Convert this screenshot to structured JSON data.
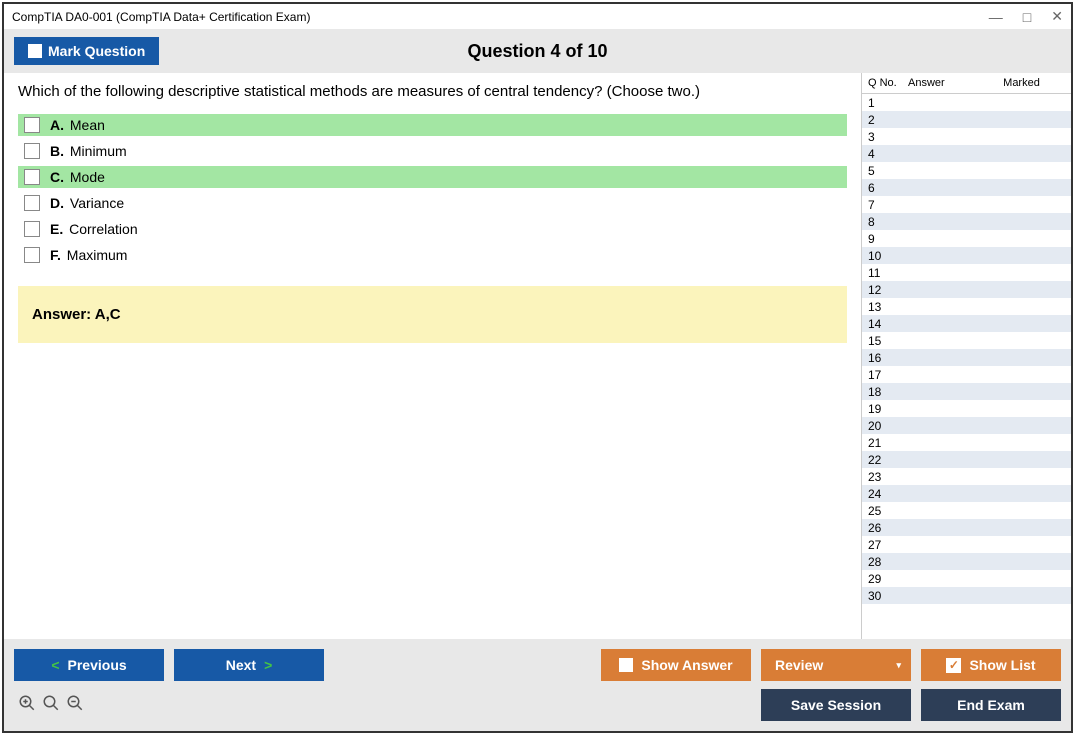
{
  "window": {
    "title": "CompTIA DA0-001 (CompTIA Data+ Certification Exam)"
  },
  "header": {
    "mark_label": "Mark Question",
    "question_title": "Question 4 of 10"
  },
  "question": {
    "text": "Which of the following descriptive statistical methods are measures of central tendency? (Choose two.)",
    "options": [
      {
        "letter": "A.",
        "text": "Mean",
        "correct": true
      },
      {
        "letter": "B.",
        "text": "Minimum",
        "correct": false
      },
      {
        "letter": "C.",
        "text": "Mode",
        "correct": true
      },
      {
        "letter": "D.",
        "text": "Variance",
        "correct": false
      },
      {
        "letter": "E.",
        "text": "Correlation",
        "correct": false
      },
      {
        "letter": "F.",
        "text": "Maximum",
        "correct": false
      }
    ],
    "answer_label": "Answer: A,C"
  },
  "side": {
    "col_qno": "Q No.",
    "col_answer": "Answer",
    "col_marked": "Marked",
    "rows": [
      1,
      2,
      3,
      4,
      5,
      6,
      7,
      8,
      9,
      10,
      11,
      12,
      13,
      14,
      15,
      16,
      17,
      18,
      19,
      20,
      21,
      22,
      23,
      24,
      25,
      26,
      27,
      28,
      29,
      30
    ]
  },
  "footer": {
    "previous": "Previous",
    "next": "Next",
    "show_answer": "Show Answer",
    "review": "Review",
    "show_list": "Show List",
    "save_session": "Save Session",
    "end_exam": "End Exam"
  }
}
